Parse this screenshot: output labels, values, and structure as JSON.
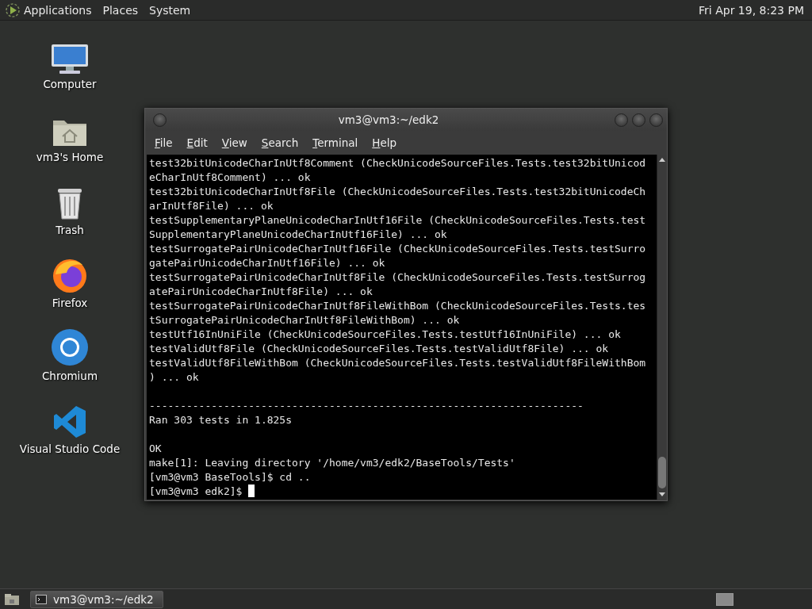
{
  "top_panel": {
    "menus": [
      "Applications",
      "Places",
      "System"
    ],
    "clock": "Fri Apr 19,  8:23 PM"
  },
  "desktop_icons": [
    {
      "label": "Computer",
      "kind": "computer"
    },
    {
      "label": "vm3's Home",
      "kind": "home"
    },
    {
      "label": "Trash",
      "kind": "trash"
    },
    {
      "label": "Firefox",
      "kind": "firefox"
    },
    {
      "label": "Chromium",
      "kind": "chromium"
    },
    {
      "label": "Visual Studio Code",
      "kind": "vscode"
    }
  ],
  "terminal_window": {
    "title": "vm3@vm3:~/edk2",
    "menu": [
      "File",
      "Edit",
      "View",
      "Search",
      "Terminal",
      "Help"
    ],
    "lines": [
      {
        "kind": "text",
        "text": "test32bitUnicodeCharInUtf8Comment (CheckUnicodeSourceFiles.Tests.test32bitUnicod"
      },
      {
        "kind": "text",
        "text": "eCharInUtf8Comment) ... ok"
      },
      {
        "kind": "text",
        "text": "test32bitUnicodeCharInUtf8File (CheckUnicodeSourceFiles.Tests.test32bitUnicodeCh"
      },
      {
        "kind": "text",
        "text": "arInUtf8File) ... ok"
      },
      {
        "kind": "text",
        "text": "testSupplementaryPlaneUnicodeCharInUtf16File (CheckUnicodeSourceFiles.Tests.test"
      },
      {
        "kind": "text",
        "text": "SupplementaryPlaneUnicodeCharInUtf16File) ... ok"
      },
      {
        "kind": "text",
        "text": "testSurrogatePairUnicodeCharInUtf16File (CheckUnicodeSourceFiles.Tests.testSurro"
      },
      {
        "kind": "text",
        "text": "gatePairUnicodeCharInUtf16File) ... ok"
      },
      {
        "kind": "text",
        "text": "testSurrogatePairUnicodeCharInUtf8File (CheckUnicodeSourceFiles.Tests.testSurrog"
      },
      {
        "kind": "text",
        "text": "atePairUnicodeCharInUtf8File) ... ok"
      },
      {
        "kind": "text",
        "text": "testSurrogatePairUnicodeCharInUtf8FileWithBom (CheckUnicodeSourceFiles.Tests.tes"
      },
      {
        "kind": "text",
        "text": "tSurrogatePairUnicodeCharInUtf8FileWithBom) ... ok"
      },
      {
        "kind": "text",
        "text": "testUtf16InUniFile (CheckUnicodeSourceFiles.Tests.testUtf16InUniFile) ... ok"
      },
      {
        "kind": "text",
        "text": "testValidUtf8File (CheckUnicodeSourceFiles.Tests.testValidUtf8File) ... ok"
      },
      {
        "kind": "text",
        "text": "testValidUtf8FileWithBom (CheckUnicodeSourceFiles.Tests.testValidUtf8FileWithBom"
      },
      {
        "kind": "text",
        "text": ") ... ok"
      },
      {
        "kind": "blank"
      },
      {
        "kind": "text",
        "text": "----------------------------------------------------------------------"
      },
      {
        "kind": "text",
        "text": "Ran 303 tests in 1.825s"
      },
      {
        "kind": "blank"
      },
      {
        "kind": "text",
        "text": "OK"
      },
      {
        "kind": "text",
        "text": "make[1]: Leaving directory '/home/vm3/edk2/BaseTools/Tests'"
      },
      {
        "kind": "text",
        "text": "[vm3@vm3 BaseTools]$ cd .."
      },
      {
        "kind": "prompt",
        "text": "[vm3@vm3 edk2]$ "
      }
    ]
  },
  "taskbar": {
    "tasks": [
      {
        "label": "vm3@vm3:~/edk2",
        "selected": true
      }
    ]
  }
}
